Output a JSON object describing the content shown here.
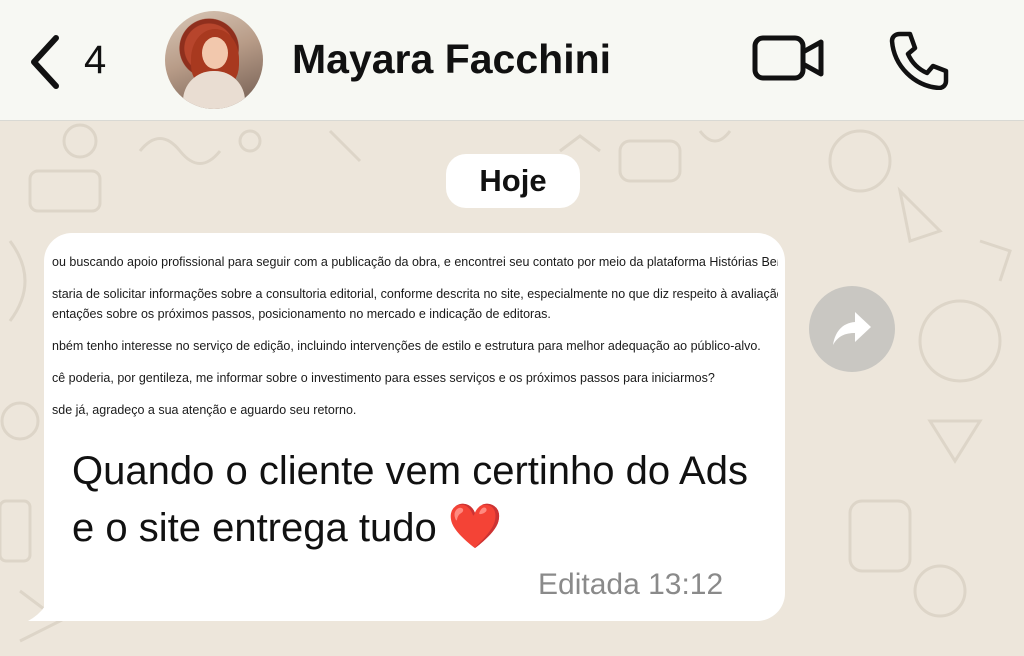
{
  "header": {
    "back_count": "4",
    "contact_name": "Mayara Facchini"
  },
  "chat": {
    "date_label": "Hoje",
    "message": {
      "screenshot_lines": [
        "ou buscando apoio profissional para seguir com a publicação da obra, e encontrei seu contato por meio da plataforma Histórias Bem Conta",
        "staria de solicitar informações sobre a consultoria editorial, conforme descrita no site, especialmente no que diz respeito à avaliação da obr",
        "entações sobre os próximos passos, posicionamento no mercado e indicação de editoras.",
        "nbém tenho interesse no serviço de edição, incluindo intervenções de estilo e estrutura para melhor adequação ao público-alvo.",
        "cê poderia, por gentileza, me informar sobre o investimento para esses serviços e os próximos passos para iniciarmos?",
        "sde já, agradeço a  sua atenção e aguardo seu retorno."
      ],
      "caption": "Quando o cliente vem certinho do Ads e o site entrega tudo",
      "emoji": "❤️",
      "status": "Editada",
      "time": "13:12"
    }
  },
  "icons": {
    "back": "chevron-left-icon",
    "video": "video-camera-icon",
    "call": "phone-icon",
    "forward": "forward-arrow-icon"
  },
  "colors": {
    "header_bg": "#f7f8f3",
    "chat_bg": "#ede6db",
    "bubble_bg": "#ffffff",
    "heart": "#e3202b",
    "forward_bg": "#c9c7c2"
  }
}
